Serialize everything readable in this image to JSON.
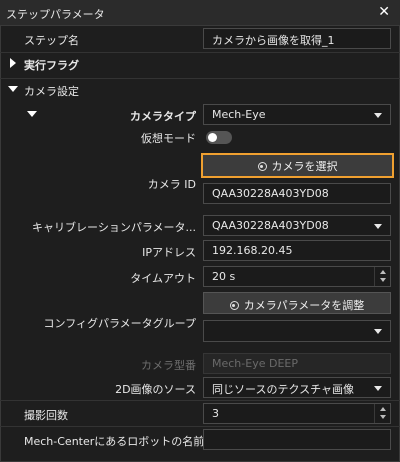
{
  "window": {
    "title": "ステップパラメータ",
    "close_icon": "close-icon"
  },
  "step_name": {
    "label": "ステップ名",
    "value": "カメラから画像を取得_1"
  },
  "execution_flag": {
    "label": "実行フラグ"
  },
  "camera_settings": {
    "label": "カメラ設定",
    "camera_type": {
      "label": "カメラタイプ",
      "value": "Mech-Eye"
    },
    "virtual_mode": {
      "label": "仮想モード",
      "enabled": false
    },
    "select_camera_button": "カメラを選択",
    "camera_id": {
      "label": "カメラ ID",
      "value": "QAA30228A403YD08"
    },
    "calibration_params": {
      "label": "キャリブレーションパラメータ...",
      "value": "QAA30228A403YD08"
    },
    "ip_address": {
      "label": "IPアドレス",
      "value": "192.168.20.45"
    },
    "timeout": {
      "label": "タイムアウト",
      "value": "20 s"
    },
    "adjust_params_button": "カメラパラメータを調整",
    "config_param_group": {
      "label": "コンフィグパラメータグループ",
      "value": ""
    },
    "camera_model": {
      "label": "カメラ型番",
      "value": "Mech-Eye DEEP"
    },
    "image_source_2d": {
      "label": "2D画像のソース",
      "value": "同じソースのテクスチャ画像"
    }
  },
  "capture_count": {
    "label": "撮影回数",
    "value": "3"
  },
  "robot_name": {
    "label": "Mech-Centerにあるロボットの名前",
    "value": ""
  },
  "colors": {
    "background": "#1e1e1e",
    "focus_accent": "#f0a030"
  }
}
